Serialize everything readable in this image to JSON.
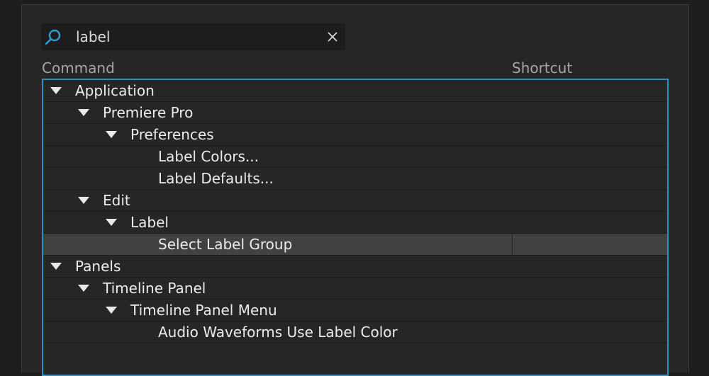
{
  "search": {
    "value": "label",
    "icon": "search-icon",
    "clear_icon": "close-icon"
  },
  "columns": {
    "command": "Command",
    "shortcut": "Shortcut"
  },
  "colors": {
    "accent": "#2f8fbf",
    "selected_row": "#414141"
  },
  "tree": [
    {
      "label": "Application",
      "level": 0,
      "expandable": true,
      "selected": false
    },
    {
      "label": "Premiere Pro",
      "level": 1,
      "expandable": true,
      "selected": false
    },
    {
      "label": "Preferences",
      "level": 2,
      "expandable": true,
      "selected": false
    },
    {
      "label": "Label Colors...",
      "level": 3,
      "expandable": false,
      "selected": false
    },
    {
      "label": "Label Defaults...",
      "level": 3,
      "expandable": false,
      "selected": false
    },
    {
      "label": "Edit",
      "level": 1,
      "expandable": true,
      "selected": false
    },
    {
      "label": "Label",
      "level": 2,
      "expandable": true,
      "selected": false
    },
    {
      "label": "Select Label Group",
      "level": 3,
      "expandable": false,
      "selected": true
    },
    {
      "label": "Panels",
      "level": 0,
      "expandable": true,
      "selected": false
    },
    {
      "label": "Timeline Panel",
      "level": 1,
      "expandable": true,
      "selected": false
    },
    {
      "label": "Timeline Panel Menu",
      "level": 2,
      "expandable": true,
      "selected": false
    },
    {
      "label": "Audio Waveforms Use Label Color",
      "level": 3,
      "expandable": false,
      "selected": false
    }
  ]
}
